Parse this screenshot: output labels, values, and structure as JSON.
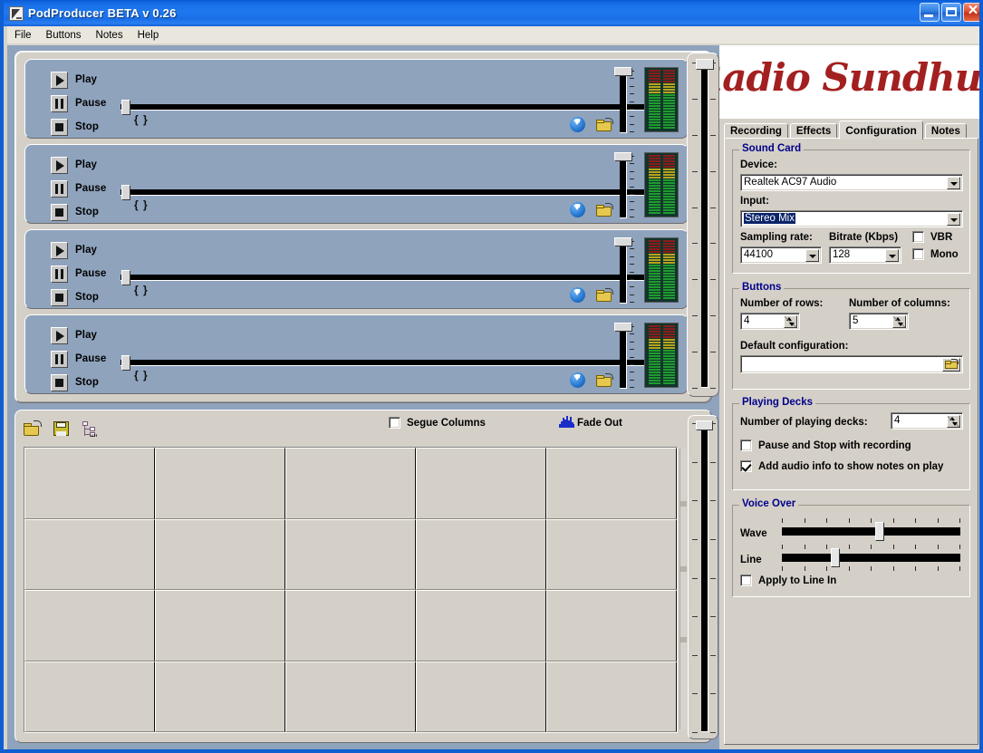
{
  "window": {
    "title": "PodProducer BETA v 0.26",
    "icon": "document-icon",
    "buttons": {
      "minimize": "minimize-icon",
      "maximize": "maximize-icon",
      "close": "✕"
    }
  },
  "menubar": {
    "items": [
      "File",
      "Buttons",
      "Notes",
      "Help"
    ]
  },
  "decks": {
    "count": 4,
    "transport": {
      "play": "Play",
      "pause": "Pause",
      "stop": "Stop"
    },
    "braces": "{     }",
    "icons": {
      "download": "download-icon",
      "open": "open-folder-icon"
    },
    "position_percent": 0,
    "fader_percent": 100,
    "vu": {
      "segments": 22,
      "red_count": 5,
      "yellow_count": 4,
      "green_count": 13,
      "red": "#8c1c1c",
      "yellow": "#b8a41e",
      "green": "#1f9b2e",
      "background": "#11352c"
    }
  },
  "master_fader": {
    "name": "master-volume-slider",
    "value_percent": 100,
    "ticks": 10
  },
  "grid_panel": {
    "toolbar": {
      "open": "open-icon",
      "save": "save-icon",
      "tree": "tree-icon",
      "segue_label": "Segue Columns",
      "segue_checked": false,
      "fade_out_label": "Fade Out",
      "fade_icon": "waveform-icon"
    },
    "rows": 4,
    "columns": 5,
    "cells": [
      [
        "",
        "",
        "",
        "",
        ""
      ],
      [
        "",
        "",
        "",
        "",
        ""
      ],
      [
        "",
        "",
        "",
        "",
        ""
      ],
      [
        "",
        "",
        "",
        "",
        ""
      ]
    ],
    "fader": {
      "name": "grid-volume-slider",
      "value_percent": 100,
      "ticks": 9
    }
  },
  "right_panel": {
    "logo": "Radio Sundhult",
    "logo_color": "#a32020",
    "tabs": [
      {
        "label": "Recording",
        "active": false
      },
      {
        "label": "Effects",
        "active": false
      },
      {
        "label": "Configuration",
        "active": true
      },
      {
        "label": "Notes",
        "active": false
      }
    ],
    "sound_card": {
      "title": "Sound Card",
      "device_label": "Device:",
      "device_value": "Realtek AC97 Audio",
      "input_label": "Input:",
      "input_value": "Stereo Mix",
      "input_selected": true,
      "sampling_rate_label": "Sampling rate:",
      "sampling_rate_value": "44100",
      "bitrate_label": "Bitrate (Kbps)",
      "bitrate_value": "128",
      "vbr_label": "VBR",
      "vbr_checked": false,
      "mono_label": "Mono",
      "mono_checked": false
    },
    "buttons_group": {
      "title": "Buttons",
      "rows_label": "Number of rows:",
      "rows_value": "4",
      "columns_label": "Number of columns:",
      "columns_value": "5",
      "default_config_label": "Default configuration:",
      "default_config_value": "",
      "browse_icon": "open-folder-icon"
    },
    "playing_decks": {
      "title": "Playing Decks",
      "count_label": "Number of playing decks:",
      "count_value": "4",
      "pause_stop_label": "Pause and Stop with recording",
      "pause_stop_checked": false,
      "add_info_label": "Add audio info to show notes on play",
      "add_info_checked": true
    },
    "voice_over": {
      "title": "Voice Over",
      "wave_label": "Wave",
      "wave_value_percent": 55,
      "line_label": "Line",
      "line_value_percent": 29,
      "apply_label": "Apply to Line In",
      "apply_checked": false,
      "tick_count": 9
    }
  },
  "colors": {
    "titlebar_blue": "#1f78ef",
    "deck_blue": "#8fa3bd",
    "face": "#d4d0c8",
    "group_title": "#00008b"
  }
}
